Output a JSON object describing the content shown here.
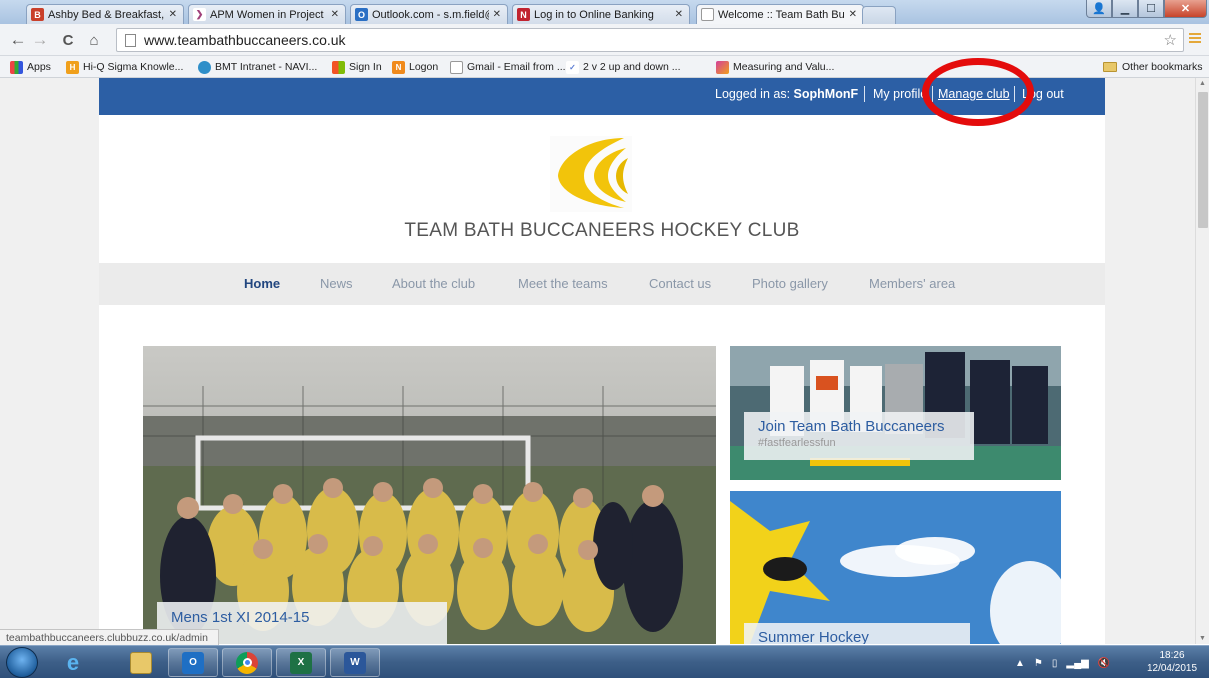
{
  "browser": {
    "tabs": [
      {
        "title": "Ashby Bed & Breakfast, Lo",
        "icon": "bnb-favicon",
        "color": "#c9402b"
      },
      {
        "title": "APM Women in Project M",
        "icon": "apm-favicon",
        "color": "#a0407a"
      },
      {
        "title": "Outlook.com - s.m.field@",
        "icon": "outlook-favicon",
        "color": "#2a6fc4"
      },
      {
        "title": "Log in to Online Banking",
        "icon": "bank-favicon",
        "color": "#c12430"
      },
      {
        "title": "Welcome :: Team Bath Bu",
        "icon": "page-favicon",
        "color": "#ffffff"
      }
    ],
    "url": "www.teambathbuccaneers.co.uk",
    "bookmarks": [
      {
        "label": "Apps",
        "icon": "apps-grid-icon"
      },
      {
        "label": "Hi-Q Sigma Knowle...",
        "icon": "hiq-icon"
      },
      {
        "label": "BMT Intranet - NAVI...",
        "icon": "bmt-icon"
      },
      {
        "label": "Sign In",
        "icon": "microsoft-icon"
      },
      {
        "label": "Logon",
        "icon": "logon-icon"
      },
      {
        "label": "Gmail - Email from ...",
        "icon": "page-icon"
      },
      {
        "label": "2 v 2 up and down ...",
        "icon": "check-icon"
      },
      {
        "label": "Measuring and Valu...",
        "icon": "measuring-icon"
      }
    ],
    "other_bookmarks": "Other bookmarks",
    "status_url": "teambathbuccaneers.clubbuzz.co.uk/admin"
  },
  "site": {
    "login": {
      "prefix": "Logged in as:",
      "user": "SophMonF",
      "profile": "My profile",
      "manage": "Manage club",
      "logout": "Log out"
    },
    "club_title": "TEAM BATH BUCCANEERS HOCKEY CLUB",
    "nav": [
      "Home",
      "News",
      "About the club",
      "Meet the teams",
      "Contact us",
      "Photo gallery",
      "Members' area"
    ],
    "hero_caption": "Mens 1st XI 2014-15",
    "cards": [
      {
        "title": "Join Team Bath Buccaneers",
        "subtitle": "#fastfearlessfun"
      },
      {
        "title": "Summer Hockey",
        "subtitle": ""
      }
    ],
    "colors": {
      "header_blue": "#2c5fa5",
      "logo_yellow": "#f2c40b",
      "annotation_red": "#e40c0c"
    }
  },
  "taskbar": {
    "apps": [
      "internet-explorer-icon",
      "file-explorer-icon",
      "outlook-icon",
      "chrome-icon",
      "excel-icon",
      "word-icon"
    ],
    "time": "18:26",
    "date": "12/04/2015"
  }
}
